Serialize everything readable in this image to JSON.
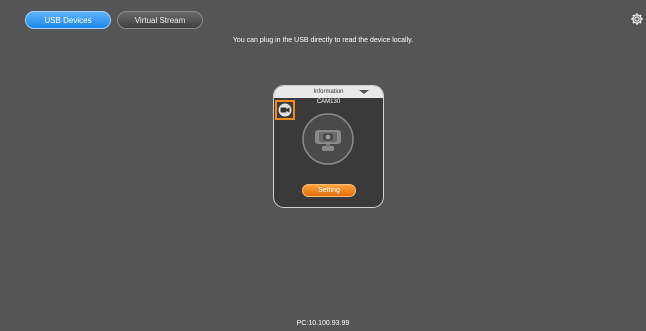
{
  "tabs": [
    {
      "label": "USB Devices",
      "active": true
    },
    {
      "label": "Virtual Stream",
      "active": false
    }
  ],
  "settings_icon": "gear-icon",
  "hint_text": "You can plug in the USB directly to read the device locally.",
  "device_card": {
    "header_label": "Information",
    "device_name": "CAM130",
    "type_icon": "camera-icon",
    "preview_icon": "webcam-icon",
    "setting_label": "Setting",
    "highlight_color": "#f08a1c"
  },
  "footer": {
    "pc_address": "PC:10.100.93.99"
  },
  "colors": {
    "background": "#555555",
    "accent": "#1d86ea",
    "button_orange": "#f08a1c"
  }
}
